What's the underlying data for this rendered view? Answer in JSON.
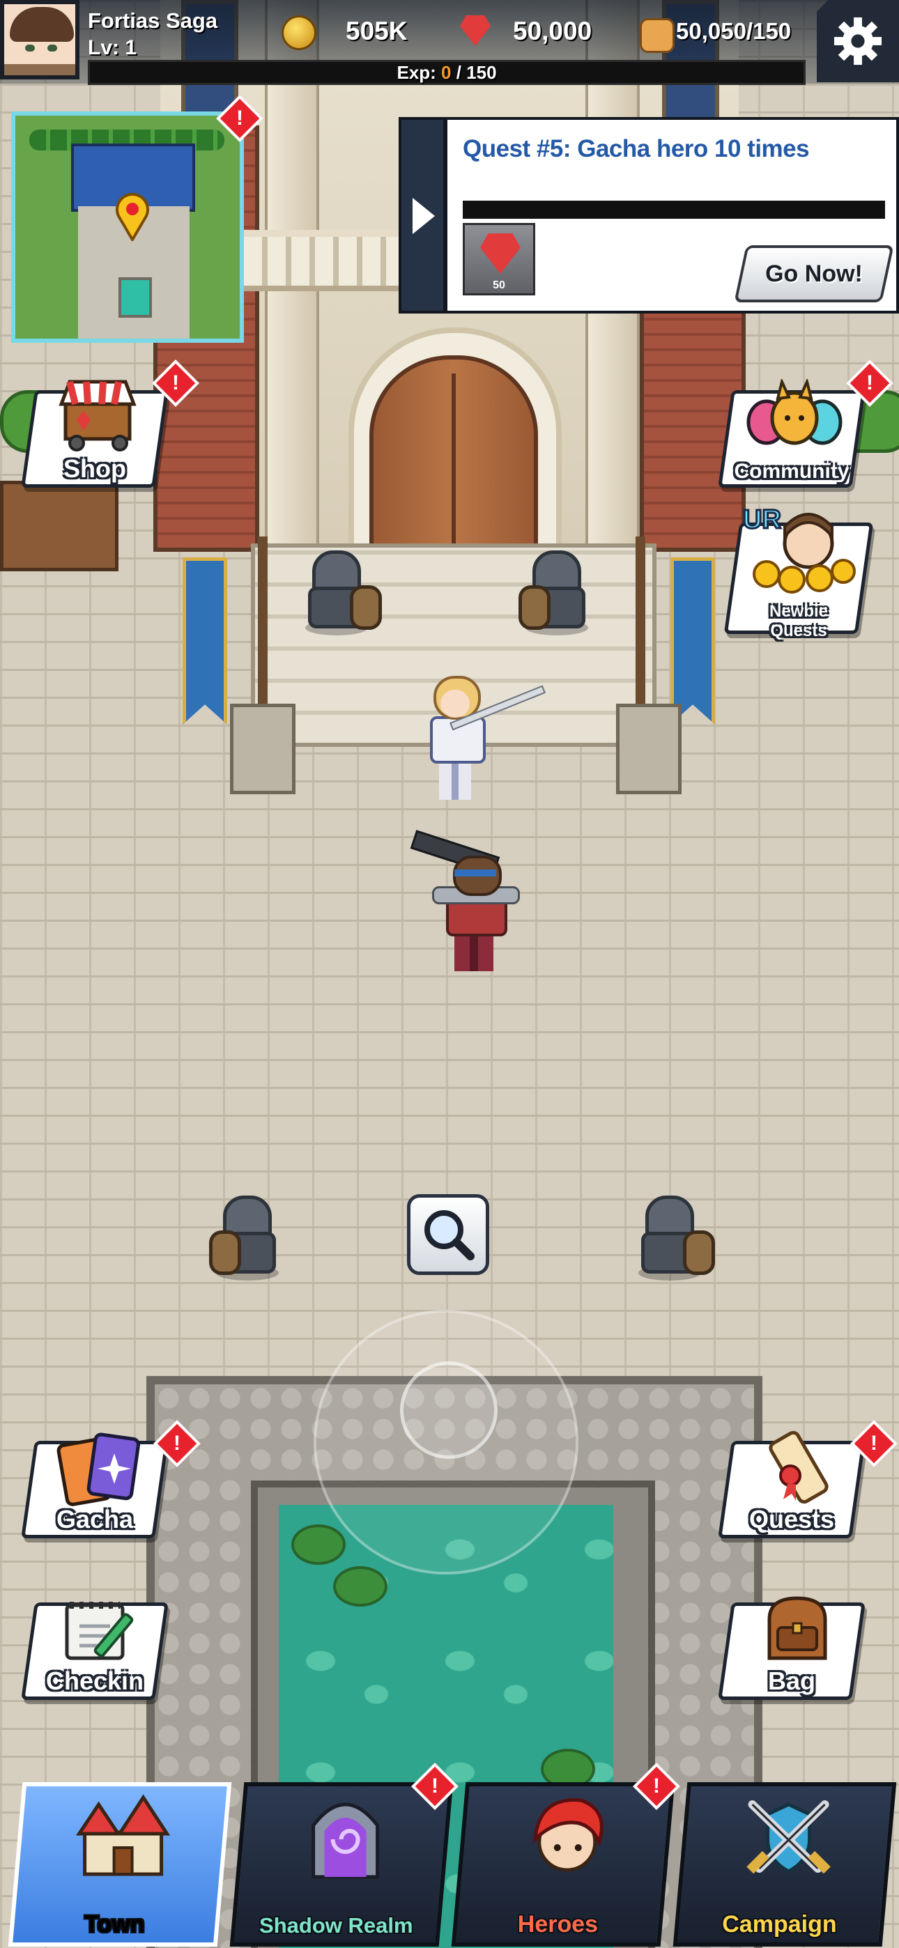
{
  "player": {
    "name": "Fortias Saga",
    "level": "Lv: 1",
    "exp_label": "Exp:",
    "exp_current": "0",
    "exp_sep": " / ",
    "exp_max": "150",
    "exp_fraction": 0
  },
  "resources": {
    "gold": {
      "icon": "gold-coin-icon",
      "value": "505K"
    },
    "gems": {
      "icon": "ruby-gem-icon",
      "value": "50,000"
    },
    "stamina": {
      "icon": "bread-icon",
      "value": "50,050/150"
    }
  },
  "settings": {
    "icon": "gear-icon"
  },
  "minimap": {
    "icon": "location-pin-icon"
  },
  "quest": {
    "title": "Quest #5: Gacha hero 10 times",
    "progress_fraction": 0,
    "reward_icon": "ruby-gem-icon",
    "reward_qty": "50",
    "go_button": "Go Now!"
  },
  "side_menu": {
    "shop": {
      "label": "Shop",
      "icon": "shop-stall-icon",
      "alert": true
    },
    "community": {
      "label": "Community",
      "icon": "community-mascots-icon",
      "alert": true
    },
    "newbie_quests": {
      "label_line1": "Newbie",
      "label_line2": "Quests",
      "badge": "UR",
      "icon": "newbie-hero-icon"
    },
    "gacha": {
      "label": "Gacha",
      "icon": "gacha-cards-icon",
      "alert": true
    },
    "quests": {
      "label": "Quests",
      "icon": "scroll-icon",
      "alert": true
    },
    "checkin": {
      "label": "Checkin",
      "icon": "calendar-icon"
    },
    "bag": {
      "label": "Bag",
      "icon": "backpack-icon"
    }
  },
  "search": {
    "icon": "magnifier-icon"
  },
  "bottom_nav": [
    {
      "label": "Town",
      "icon": "town-castle-icon",
      "color": "#ffffff",
      "active": true
    },
    {
      "label": "Shadow Realm",
      "icon": "portal-icon",
      "color": "#7fe5c9",
      "alert": true
    },
    {
      "label": "Heroes",
      "icon": "hero-face-icon",
      "color": "#ff6a4a",
      "alert": true
    },
    {
      "label": "Campaign",
      "icon": "crossed-swords-icon",
      "color": "#ffd54a"
    }
  ],
  "colors": {
    "alert": "#e8222c",
    "exp_fill": "#f18a1c",
    "quest_title": "#2459a6"
  }
}
